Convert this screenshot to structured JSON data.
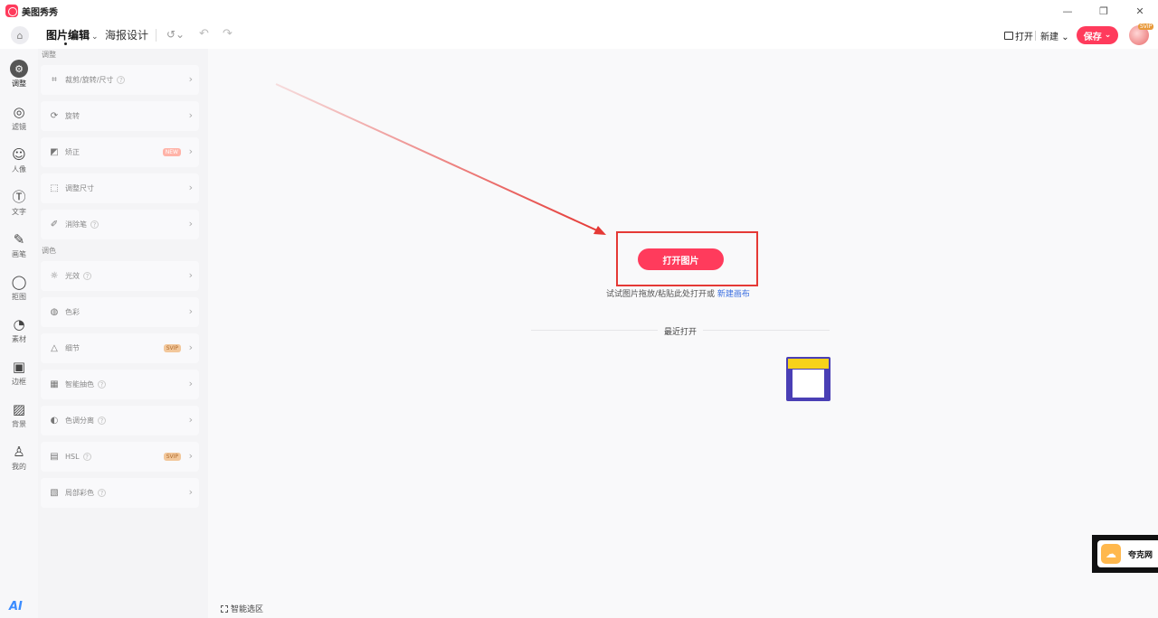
{
  "window": {
    "app_name": "美图秀秀",
    "controls": {
      "minimize": "—",
      "restore": "❐",
      "close": "✕"
    }
  },
  "toolbar": {
    "tab_image_edit": "图片编辑",
    "tab_caret": "⌄",
    "tab_poster": "海报设计",
    "history_icon": "↺⌄",
    "undo_icon": "↶",
    "redo_icon": "↷",
    "open": "打开",
    "new": "新建",
    "new_caret": "⌄",
    "save": "保存",
    "save_caret": "⌄",
    "avatar_badge": "SVIP"
  },
  "rail": {
    "items": [
      {
        "label": "调整",
        "icon": "⚙"
      },
      {
        "label": "滤镜",
        "icon": "◎"
      },
      {
        "label": "人像",
        "icon": "☺"
      },
      {
        "label": "文字",
        "icon": "Ⓣ"
      },
      {
        "label": "画笔",
        "icon": "✎"
      },
      {
        "label": "拒图",
        "icon": "◯"
      },
      {
        "label": "素材",
        "icon": "◔"
      },
      {
        "label": "边框",
        "icon": "▣"
      },
      {
        "label": "背景",
        "icon": "▨"
      },
      {
        "label": "我的",
        "icon": "♙"
      }
    ],
    "ai_badge": "AI"
  },
  "panel": {
    "sections": {
      "basic": "调整",
      "color": "调色"
    },
    "items": [
      {
        "label": "裁剪/旋转/尺寸",
        "icon": "⌗",
        "help": "?",
        "badge": ""
      },
      {
        "label": "旋转",
        "icon": "⟳",
        "help": "",
        "badge": ""
      },
      {
        "label": "矫正",
        "icon": "◩",
        "help": "",
        "badge": "NEW"
      },
      {
        "label": "调整尺寸",
        "icon": "⬚",
        "help": "",
        "badge": ""
      },
      {
        "label": "消除笔",
        "icon": "✐",
        "help": "?",
        "badge": ""
      },
      {
        "label": "光效",
        "icon": "☼",
        "help": "?",
        "badge": ""
      },
      {
        "label": "色彩",
        "icon": "◍",
        "help": "",
        "badge": ""
      },
      {
        "label": "细节",
        "icon": "△",
        "help": "",
        "badge": "SVIP"
      },
      {
        "label": "智能抽色",
        "icon": "▦",
        "help": "?",
        "badge": ""
      },
      {
        "label": "色调分离",
        "icon": "◐",
        "help": "?",
        "badge": ""
      },
      {
        "label": "HSL",
        "icon": "▤",
        "help": "?",
        "badge": "SVIP"
      },
      {
        "label": "局部彩色",
        "icon": "▧",
        "help": "?",
        "badge": ""
      }
    ],
    "chevron": "›"
  },
  "canvas": {
    "open_image": "打开图片",
    "hint_prefix": "试试图片拖放/粘贴此处打开或 ",
    "hint_link": "新建画布",
    "recent_title": "最近打开",
    "smart_select": "智能选区"
  },
  "float_widget": {
    "text": "夸克网",
    "icon": "☁"
  },
  "colors": {
    "accent": "#ff3b5c",
    "annotation": "#e53935",
    "link": "#3b6fe0"
  }
}
